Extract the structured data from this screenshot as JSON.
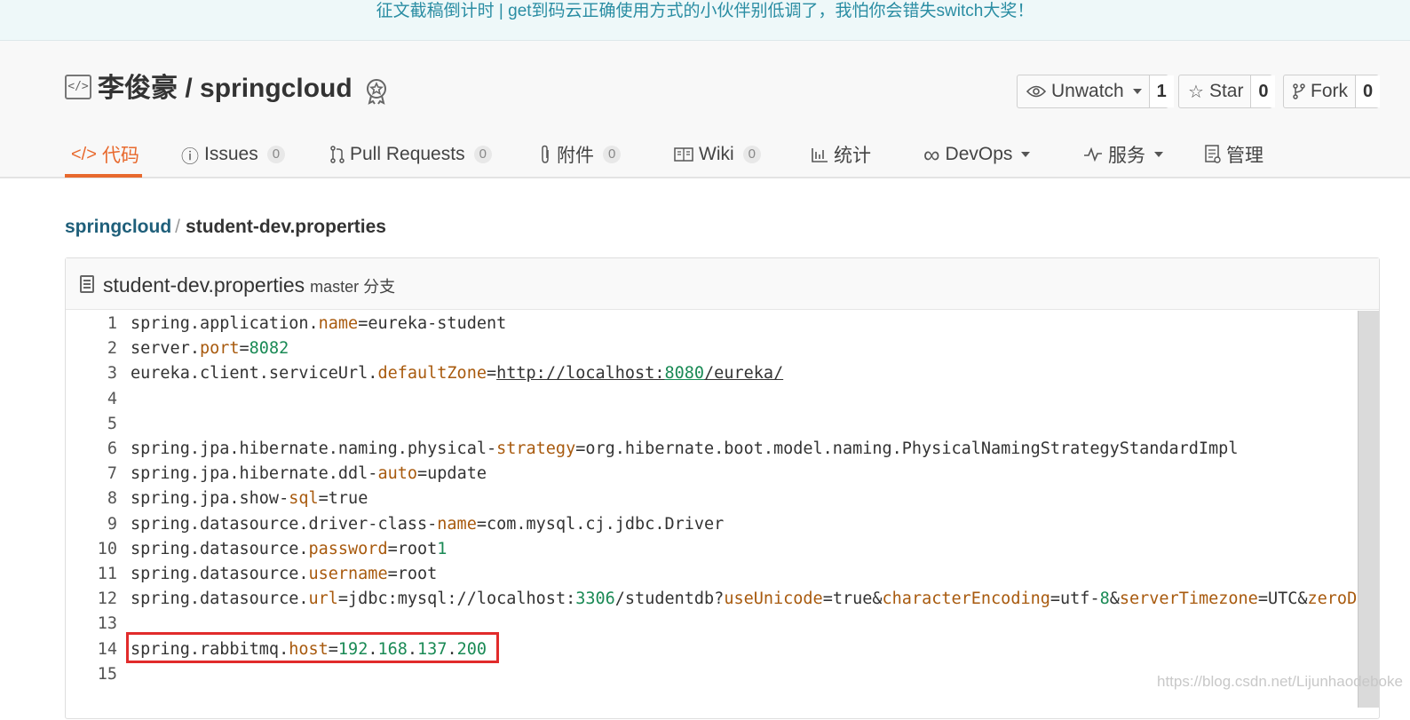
{
  "banner": {
    "text": "征文截稿倒计时 | get到码云正确使用方式的小伙伴别低调了，我怕你会错失switch大奖！"
  },
  "repo": {
    "title": "李俊豪 / springcloud"
  },
  "actions": {
    "watch": {
      "label": "Unwatch",
      "count": "1"
    },
    "star": {
      "label": "Star",
      "count": "0"
    },
    "fork": {
      "label": "Fork",
      "count": "0"
    }
  },
  "tabs": [
    {
      "label": "代码",
      "icon": "code-icon",
      "badge": ""
    },
    {
      "label": "Issues",
      "icon": "issue-icon",
      "badge": "0"
    },
    {
      "label": "Pull Requests",
      "icon": "pull-request-icon",
      "badge": "0"
    },
    {
      "label": "附件",
      "icon": "paperclip-icon",
      "badge": "0"
    },
    {
      "label": "Wiki",
      "icon": "book-icon",
      "badge": "0"
    },
    {
      "label": "统计",
      "icon": "bar-chart-icon",
      "badge": ""
    },
    {
      "label": "DevOps",
      "icon": "infinity-icon",
      "badge": ""
    },
    {
      "label": "服务",
      "icon": "pulse-icon",
      "badge": ""
    },
    {
      "label": "管理",
      "icon": "settings-doc-icon",
      "badge": ""
    }
  ],
  "breadcrumb": {
    "root": "springcloud",
    "separator": "/",
    "current": "student-dev.properties"
  },
  "file": {
    "name": "student-dev.properties",
    "branch": "master 分支",
    "lines": [
      {
        "num": "1",
        "tokens": [
          [
            "k",
            "spring.application."
          ],
          [
            "p",
            "name"
          ],
          [
            "k",
            "=eureka-student"
          ]
        ]
      },
      {
        "num": "2",
        "tokens": [
          [
            "k",
            "server."
          ],
          [
            "p",
            "port"
          ],
          [
            "k",
            "="
          ],
          [
            "n",
            "8082"
          ]
        ]
      },
      {
        "num": "3",
        "tokens": [
          [
            "k",
            "eureka.client.serviceUrl."
          ],
          [
            "p",
            "defaultZone"
          ],
          [
            "k",
            "="
          ],
          [
            "ku",
            "http://localhost:"
          ],
          [
            "nu",
            "8080"
          ],
          [
            "ku",
            "/eureka/"
          ]
        ]
      },
      {
        "num": "4",
        "tokens": []
      },
      {
        "num": "5",
        "tokens": []
      },
      {
        "num": "6",
        "tokens": [
          [
            "k",
            "spring.jpa.hibernate.naming.physical-"
          ],
          [
            "p",
            "strategy"
          ],
          [
            "k",
            "=org.hibernate.boot.model.naming.PhysicalNamingStrategyStandardImpl"
          ]
        ]
      },
      {
        "num": "7",
        "tokens": [
          [
            "k",
            "spring.jpa.hibernate.ddl-"
          ],
          [
            "p",
            "auto"
          ],
          [
            "k",
            "=update"
          ]
        ]
      },
      {
        "num": "8",
        "tokens": [
          [
            "k",
            "spring.jpa.show-"
          ],
          [
            "p",
            "sql"
          ],
          [
            "k",
            "=true"
          ]
        ]
      },
      {
        "num": "9",
        "tokens": [
          [
            "k",
            "spring.datasource.driver-class-"
          ],
          [
            "p",
            "name"
          ],
          [
            "k",
            "=com.mysql.cj.jdbc.Driver"
          ]
        ]
      },
      {
        "num": "10",
        "tokens": [
          [
            "k",
            "spring.datasource."
          ],
          [
            "p",
            "password"
          ],
          [
            "k",
            "=root"
          ],
          [
            "n",
            "1"
          ]
        ]
      },
      {
        "num": "11",
        "tokens": [
          [
            "k",
            "spring.datasource."
          ],
          [
            "p",
            "username"
          ],
          [
            "k",
            "=root"
          ]
        ]
      },
      {
        "num": "12",
        "tokens": [
          [
            "k",
            "spring.datasource."
          ],
          [
            "p",
            "url"
          ],
          [
            "k",
            "=jdbc:mysql://localhost:"
          ],
          [
            "n",
            "3306"
          ],
          [
            "k",
            "/studentdb?"
          ],
          [
            "p",
            "useUnicode"
          ],
          [
            "k",
            "=true&"
          ],
          [
            "p",
            "characterEncoding"
          ],
          [
            "k",
            "=utf-"
          ],
          [
            "n",
            "8"
          ],
          [
            "k",
            "&"
          ],
          [
            "p",
            "serverTimezone"
          ],
          [
            "k",
            "=UTC&"
          ],
          [
            "p",
            "zeroD"
          ]
        ]
      },
      {
        "num": "13",
        "tokens": []
      },
      {
        "num": "14",
        "tokens": [
          [
            "k",
            "spring.rabbitmq."
          ],
          [
            "p",
            "host"
          ],
          [
            "k",
            "="
          ],
          [
            "n",
            "192"
          ],
          [
            "k",
            "."
          ],
          [
            "n",
            "168"
          ],
          [
            "k",
            "."
          ],
          [
            "n",
            "137"
          ],
          [
            "k",
            "."
          ],
          [
            "n",
            "200"
          ]
        ]
      },
      {
        "num": "15",
        "tokens": []
      }
    ]
  },
  "watermark": "https://blog.csdn.net/Lijunhaodeboke",
  "colors": {
    "accent": "#e8692d",
    "link": "#1f5f7a",
    "banner": "#2a8da3",
    "highlight": "#e12b2b"
  }
}
